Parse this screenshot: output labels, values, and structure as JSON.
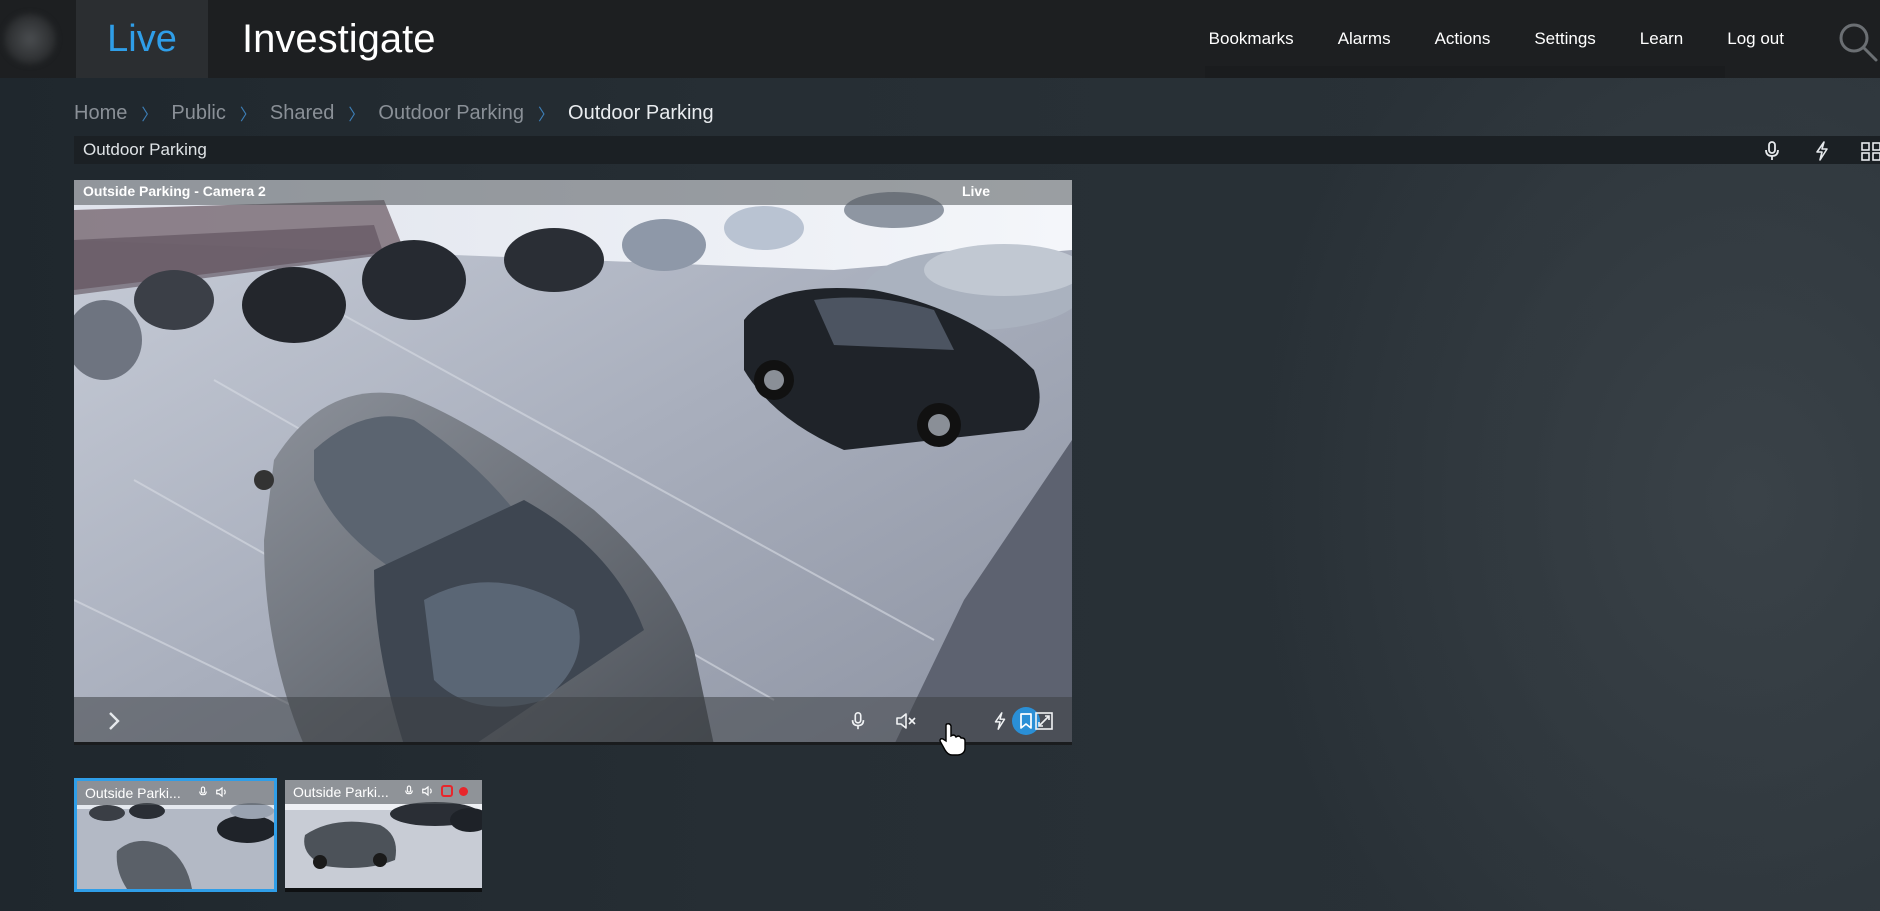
{
  "header": {
    "tabs": [
      {
        "label": "Live",
        "active": true
      },
      {
        "label": "Investigate",
        "active": false
      }
    ],
    "nav": [
      "Bookmarks",
      "Alarms",
      "Actions",
      "Settings",
      "Learn",
      "Log out"
    ],
    "accent": "#2f9ee8"
  },
  "breadcrumb": [
    "Home",
    "Public",
    "Shared",
    "Outdoor Parking",
    "Outdoor Parking"
  ],
  "view": {
    "title": "Outdoor Parking",
    "toolbar_icons": [
      "microphone-icon",
      "lightning-icon",
      "grid-layout-icon"
    ]
  },
  "camera": {
    "title": "Outside Parking - Camera 2",
    "status": "Live",
    "controls": [
      "microphone-icon",
      "speaker-muted-icon",
      "bookmark-icon",
      "lightning-icon",
      "fullscreen-icon"
    ],
    "active_control": "bookmark-icon"
  },
  "thumbnails": [
    {
      "title": "Outside Parki...",
      "selected": true,
      "icons": [
        "microphone-icon",
        "speaker-icon"
      ]
    },
    {
      "title": "Outside Parki...",
      "selected": false,
      "icons": [
        "microphone-icon",
        "speaker-icon",
        "record-icon",
        "recording-dot"
      ],
      "record_color": "#e8262b"
    }
  ]
}
